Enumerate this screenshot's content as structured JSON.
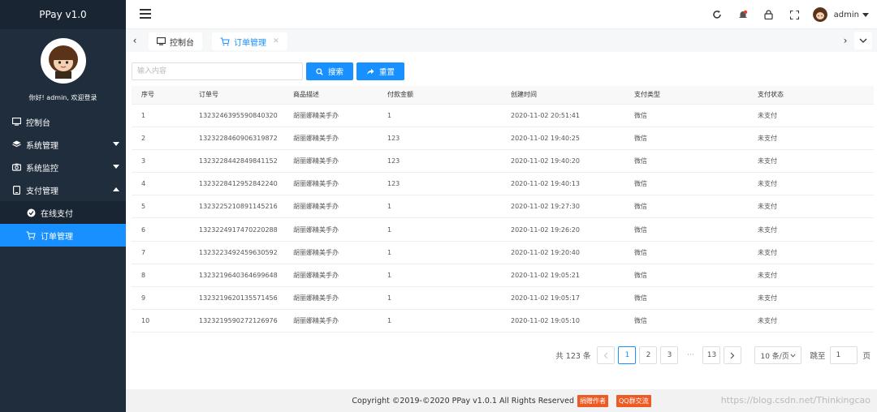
{
  "app": {
    "title": "PPay v1.0"
  },
  "sidebar": {
    "greeting": "你好! admin, 欢迎登录",
    "items": [
      {
        "label": "控制台",
        "icon": "monitor-icon"
      },
      {
        "label": "系统管理",
        "icon": "layers-icon"
      },
      {
        "label": "系统监控",
        "icon": "camera-icon"
      },
      {
        "label": "支付管理",
        "icon": "tablet-icon"
      }
    ],
    "subitems": [
      {
        "label": "在线支付",
        "icon": "circle-icon"
      },
      {
        "label": "订单管理",
        "icon": "cart-icon"
      }
    ]
  },
  "header": {
    "username": "admin"
  },
  "tabs": [
    {
      "label": "控制台"
    },
    {
      "label": "订单管理"
    }
  ],
  "search": {
    "placeholder": "输入内容",
    "search_label": "搜索",
    "reset_label": "重置"
  },
  "table": {
    "headers": [
      "序号",
      "订单号",
      "商品描述",
      "付款金额",
      "创建时间",
      "支付类型",
      "支付状态"
    ],
    "rows": [
      [
        "1",
        "1323246395590840320",
        "胡丽娜精美手办",
        "1",
        "2020-11-02 20:51:41",
        "微信",
        "未支付"
      ],
      [
        "2",
        "1323228460906319872",
        "胡丽娜精美手办",
        "123",
        "2020-11-02 19:40:25",
        "微信",
        "未支付"
      ],
      [
        "3",
        "1323228442849841152",
        "胡丽娜精美手办",
        "123",
        "2020-11-02 19:40:20",
        "微信",
        "未支付"
      ],
      [
        "4",
        "1323228412952842240",
        "胡丽娜精美手办",
        "123",
        "2020-11-02 19:40:13",
        "微信",
        "未支付"
      ],
      [
        "5",
        "1323225210891145216",
        "胡丽娜精美手办",
        "1",
        "2020-11-02 19:27:30",
        "微信",
        "未支付"
      ],
      [
        "6",
        "1323224917470220288",
        "胡丽娜精美手办",
        "1",
        "2020-11-02 19:26:20",
        "微信",
        "未支付"
      ],
      [
        "7",
        "1323223492459630592",
        "胡丽娜精美手办",
        "1",
        "2020-11-02 19:20:40",
        "微信",
        "未支付"
      ],
      [
        "8",
        "1323219640364699648",
        "胡丽娜精美手办",
        "1",
        "2020-11-02 19:05:21",
        "微信",
        "未支付"
      ],
      [
        "9",
        "1323219620135571456",
        "胡丽娜精美手办",
        "1",
        "2020-11-02 19:05:17",
        "微信",
        "未支付"
      ],
      [
        "10",
        "1323219590272126976",
        "胡丽娜精美手办",
        "1",
        "2020-11-02 19:05:10",
        "微信",
        "未支付"
      ]
    ]
  },
  "pagination": {
    "total": "共 123 条",
    "pages": [
      "1",
      "2",
      "3"
    ],
    "ellipsis": "···",
    "last": "13",
    "page_size": "10 条/页",
    "jump_label": "跳至",
    "jump_value": "1",
    "jump_suffix": "页"
  },
  "footer": {
    "copyright": "Copyright ©2019-©2020 PPay v1.0.1 All Rights Reserved",
    "badge1": "捐赠作者",
    "badge2": "QQ群交流",
    "watermark": "https://blog.csdn.net/Thinkingcao"
  },
  "colors": {
    "sidebar_bg": "#1f2d3d",
    "accent": "#1890ff",
    "badge": "#ee5a24"
  }
}
